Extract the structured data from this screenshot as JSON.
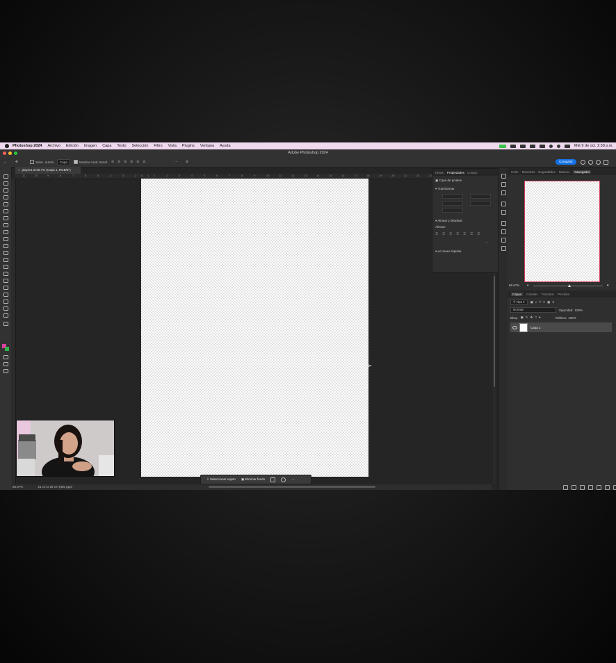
{
  "menubar": {
    "app": "Photoshop 2024",
    "items": [
      "Archivo",
      "Edición",
      "Imagen",
      "Capa",
      "Texto",
      "Selección",
      "Filtro",
      "Vista",
      "Plugins",
      "Ventana",
      "Ayuda"
    ],
    "clock": "Mié 9 de oct. 2:39 p.m."
  },
  "titlebar": {
    "title": "Adobe Photoshop 2024"
  },
  "options": {
    "auto_select": "Selec. autom.",
    "target": "Capa",
    "show_transform": "Mostrar contr. transf.",
    "share": "Compartir"
  },
  "document": {
    "tab": "playera al 66.7% (Capa 1, RGB/8*)",
    "zoom": "66.67%",
    "size_info": "21 cm x 29 cm (300 ppp)"
  },
  "ruler_marks": [
    "11",
    "10",
    "9",
    "8",
    "7",
    "6",
    "5",
    "4",
    "3",
    "2",
    "1",
    "0",
    "1",
    "2",
    "3",
    "4",
    "5",
    "6",
    "7",
    "8",
    "9",
    "10",
    "11",
    "12",
    "13",
    "14",
    "15",
    "16",
    "17",
    "18",
    "19",
    "20",
    "21",
    "22",
    "23",
    "24",
    "25",
    "26"
  ],
  "context_bar": {
    "select_subject": "Seleccionar sujeto",
    "remove_bg": "Eliminar fondo"
  },
  "properties": {
    "tabs": [
      "Histori",
      "Propiedades",
      "Compo"
    ],
    "layer_type": "Capa de píxeles",
    "transform": "Transformar",
    "align": "Alinear y distribuir",
    "align_sub": "Alinear:",
    "quick_actions": "Acciones rápidas"
  },
  "top_dock": {
    "tabs": [
      "Color",
      "Muestras",
      "Degradados",
      "Motivos",
      "Navegador"
    ]
  },
  "navigator": {
    "zoom": "66.67%"
  },
  "layers": {
    "tabs": [
      "Capas",
      "Canales",
      "Trazados",
      "Pinceles"
    ],
    "filter": "Tipo",
    "blend": "Normal",
    "opacity_label": "Opacidad:",
    "opacity": "100%",
    "lock_label": "Bloq.:",
    "fill_label": "Relleno:",
    "fill": "100%",
    "layer_name": "Capa 1"
  },
  "colors": {
    "foreground": "#e040a0",
    "background": "#2fb34a",
    "accent": "#1473e6",
    "menubar": "#f0d9ee"
  }
}
